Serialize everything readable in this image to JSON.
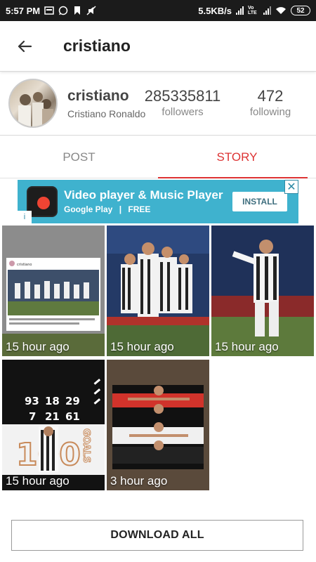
{
  "status_bar": {
    "time": "5:57 PM",
    "network_speed": "5.5KB/s",
    "volte_label": "Vo LTE",
    "battery": "52",
    "icons": [
      "gallery-icon",
      "whatsapp-icon",
      "bookmark-icon",
      "mute-icon",
      "signal-icon",
      "wifi-icon"
    ]
  },
  "app_bar": {
    "back_icon": "arrow-left-icon",
    "title": "cristiano"
  },
  "profile": {
    "username": "cristiano",
    "full_name": "Cristiano Ronaldo",
    "followers_count": "285335811",
    "followers_label": "followers",
    "following_count": "472",
    "following_label": "following"
  },
  "tabs": [
    {
      "label": "POST",
      "active": false
    },
    {
      "label": "STORY",
      "active": true
    }
  ],
  "ad": {
    "title": "Video player & Music Player",
    "store": "Google Play",
    "price": "FREE",
    "install_label": "INSTALL",
    "close_label": "✕",
    "info_label": "i"
  },
  "stories": [
    {
      "time": "15 hour ago"
    },
    {
      "time": "15 hour ago"
    },
    {
      "time": "15 hour ago"
    },
    {
      "time": "15 hour ago"
    },
    {
      "time": "3 hour ago"
    }
  ],
  "story_thumbnail_text": {
    "post_handle": "cristiano",
    "stats": [
      "93",
      "18",
      "29",
      "7",
      "21",
      "61"
    ],
    "badge": "100",
    "badge_suffix": "GOALS"
  },
  "download_all_label": "DOWNLOAD ALL",
  "colors": {
    "accent": "#dd3333",
    "status_bar": "#1b1b1b",
    "ad_background": "#3fb2ce"
  }
}
